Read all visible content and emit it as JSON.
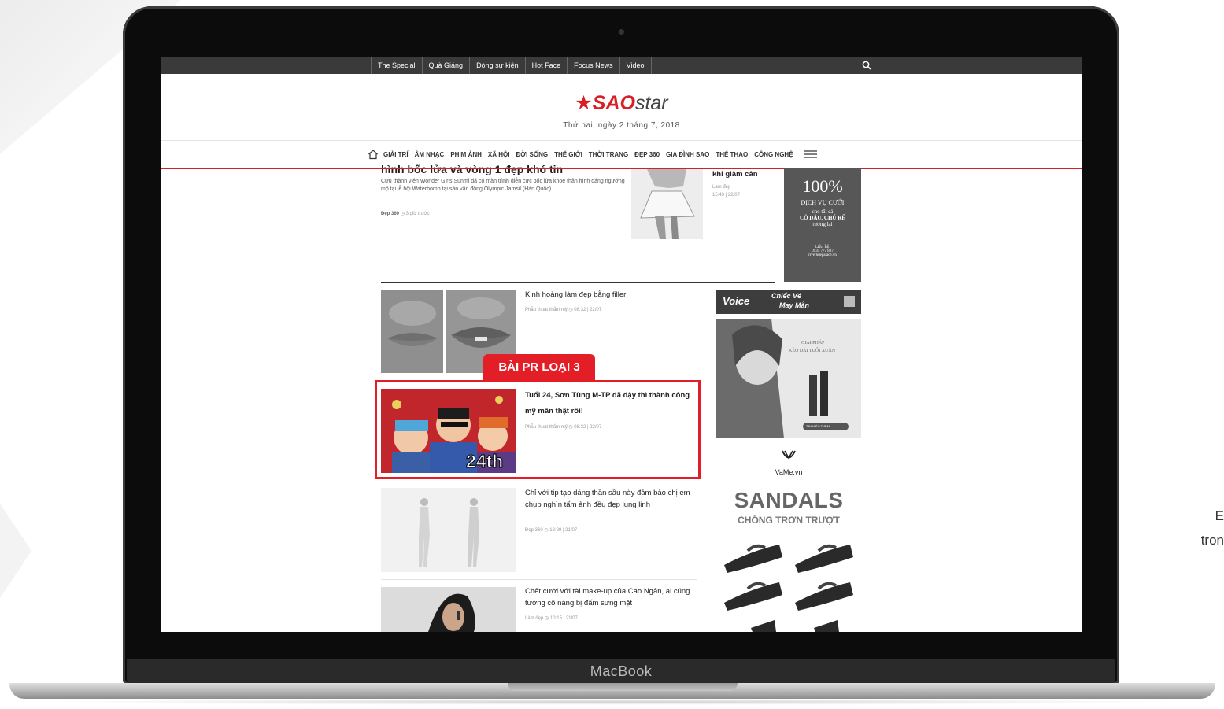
{
  "colors": {
    "brand_red": "#d81f26",
    "nav_bg": "#3a3a3a",
    "laptop": "#0c0c0c"
  },
  "side_text": {
    "line1": "E",
    "line2": "tron"
  },
  "device": {
    "brand": "MacBook"
  },
  "topnav": {
    "items": [
      "The Special",
      "Quà Giáng",
      "Dòng sự kiện",
      "Hot Face",
      "Focus News",
      "Video"
    ],
    "search_icon": "search-icon"
  },
  "masthead": {
    "logo_star": "★",
    "logo_sao": "SAO",
    "logo_star_word": "star",
    "date": "Thứ hai, ngày 2 tháng 7, 2018"
  },
  "catnav": {
    "home_icon": "home-icon",
    "items": [
      "GIẢI TRÍ",
      "ÂM NHẠC",
      "PHIM ẢNH",
      "XÃ HỘI",
      "ĐỜI SỐNG",
      "THẾ GIỚI",
      "THỜI TRANG",
      "ĐẸP 360",
      "GIA ĐÌNH SAO",
      "THỂ THAO",
      "CÔNG NGHỆ"
    ],
    "menu_icon": "hamburger-menu-icon"
  },
  "lead": {
    "title": "hình bốc lửa và vòng 1 đẹp khó tin",
    "desc": "Cựu thành viên Wonder Girls Sunmi đã có màn trình diễn cực bốc lửa khoe thân hình đáng ngưỡng mộ tại lễ hội Waterbomb tại sân vận động Olympic Jamsil (Hàn Quốc)",
    "category": "Đẹp 360",
    "time": "3 giờ trước"
  },
  "side_article": {
    "title": "khi giảm cân",
    "category": "Làm đẹp",
    "time": "15:43 | 22/07"
  },
  "ad_top": {
    "line1": "100%",
    "line2": "DỊCH VỤ CƯỚI",
    "line3": "cho tất cả",
    "line4": "CÔ DÂU, CHÚ RỂ",
    "line5": "tương lai",
    "line6": "Liên hệ:",
    "line7": "0934 777 837",
    "line8": "riverhdepalace.vn"
  },
  "articles": [
    {
      "title": "Kinh hoàng làm đẹp bằng filler",
      "category": "Phẫu thuật thẩm mỹ",
      "time": "08:32 | 22/07"
    },
    {
      "title": "Tuổi 24, Sơn Tùng M-TP đã dậy thì thành công mỹ mãn thật rồi!",
      "category": "Phẫu thuật thẩm mỹ",
      "time": "08:32 | 22/07",
      "badge": "24th"
    },
    {
      "title": "Chỉ với tip tạo dáng thần sầu này đảm bảo chị em chụp nghìn tấm ảnh đều đẹp lung linh",
      "category": "Đẹp 360",
      "time": "13:29 | 21/07"
    },
    {
      "title": "Chết cười với tài make-up của Cao Ngân, ai cũng tưởng cô nàng bị đấm sưng mặt",
      "category": "Làm đẹp",
      "time": "10:15 | 21/07"
    }
  ],
  "pr_label": "BÀI PR LOẠI 3",
  "banner_voice": {
    "text1": "Voice",
    "text2": "Chiếc Vé",
    "text3": "May Mắn"
  },
  "banner_beauty": {
    "text1": "GIẢI PHÁP",
    "text2": "KÉO DÀI TUỔI XUÂN",
    "button": "TÌM HIỂU THÊM"
  },
  "banner_sandals": {
    "brand": "VaMe.vn",
    "headline": "SANDALS",
    "subline": "CHỐNG TRƠN TRƯỢT"
  }
}
